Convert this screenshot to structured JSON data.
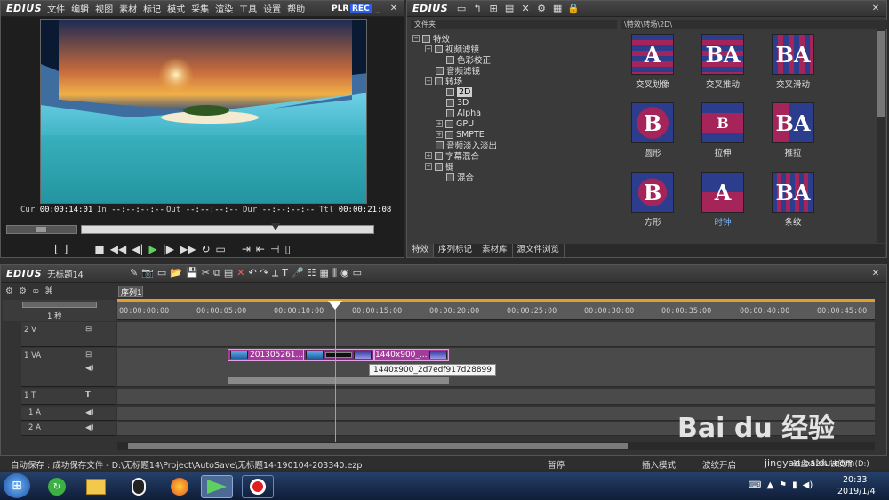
{
  "player": {
    "logo": "EDIUS",
    "menu": [
      "文件",
      "编辑",
      "视图",
      "素材",
      "标记",
      "模式",
      "采集",
      "渲染",
      "工具",
      "设置",
      "帮助"
    ],
    "plr": "PLR",
    "rec": "REC",
    "timecodes": {
      "cur_label": "Cur",
      "cur": "00:00:14:01",
      "in_label": "In",
      "in": "--:--:--:--",
      "out_label": "Out",
      "out": "--:--:--:--",
      "dur_label": "Dur",
      "dur": "--:--:--:--",
      "ttl_label": "Ttl",
      "ttl": "00:00:21:08"
    }
  },
  "bin": {
    "logo": "EDIUS",
    "tree_header": "文件夹",
    "path": "\\特效\\转场\\2D\\",
    "tree": [
      {
        "label": "特效",
        "level": 0
      },
      {
        "label": "视频滤镜",
        "level": 1
      },
      {
        "label": "色彩校正",
        "level": 2
      },
      {
        "label": "音频滤镜",
        "level": 1
      },
      {
        "label": "转场",
        "level": 1
      },
      {
        "label": "2D",
        "level": 2,
        "selected": true
      },
      {
        "label": "3D",
        "level": 2
      },
      {
        "label": "Alpha",
        "level": 2
      },
      {
        "label": "GPU",
        "level": 2
      },
      {
        "label": "SMPTE",
        "level": 2
      },
      {
        "label": "音频淡入淡出",
        "level": 1
      },
      {
        "label": "字幕混合",
        "level": 1
      },
      {
        "label": "键",
        "level": 1
      },
      {
        "label": "混合",
        "level": 2
      }
    ],
    "effects": [
      {
        "label": "交叉划像",
        "glyph": "A"
      },
      {
        "label": "交叉推动",
        "glyph": "BA"
      },
      {
        "label": "交叉滑动",
        "glyph": "BA"
      },
      {
        "label": "圆形",
        "glyph": "B"
      },
      {
        "label": "拉伸",
        "glyph": "B"
      },
      {
        "label": "推拉",
        "glyph": "BA"
      },
      {
        "label": "方形",
        "glyph": "B"
      },
      {
        "label": "时钟",
        "glyph": "A"
      },
      {
        "label": "条纹",
        "glyph": "BA"
      }
    ],
    "tabs": [
      "特效",
      "序列标记",
      "素材库",
      "源文件浏览"
    ]
  },
  "timeline": {
    "logo": "EDIUS",
    "project": "无标题14",
    "sequence_tab": "序列1",
    "zoom": "1 秒",
    "ruler": [
      "00:00:00:00",
      "00:00:05:00",
      "00:00:10:00",
      "00:00:15:00",
      "00:00:20:00",
      "00:00:25:00",
      "00:00:30:00",
      "00:00:35:00",
      "00:00:40:00",
      "00:00:45:00"
    ],
    "tracks": [
      {
        "label": "2 V"
      },
      {
        "label": "1 VA"
      },
      {
        "label": "1 T"
      },
      {
        "label": "1 A"
      },
      {
        "label": "2 A"
      }
    ],
    "clip1": "201305261...",
    "clip2": "1440x900_...",
    "tooltip": "1440x900_2d7edf917d28899"
  },
  "status": {
    "autosave": "自动保存 : 成功保存文件 - D:\\无标题14\\Project\\AutoSave\\无标题14-190104-203340.ezp",
    "paused": "暂停",
    "insert": "插入模式",
    "ripple": "波纹开启",
    "disk": "磁盘:52% 被使用 (D:)"
  },
  "taskbar": {
    "time": "20:33",
    "date": "2019/1/4"
  },
  "watermark": {
    "brand": "Bai du 经验",
    "url": "jingyan.baidu.com"
  },
  "colors": {
    "accent_rec": "#2f5fe0",
    "clip": "#a33b9c",
    "playhead": "#46c9c0"
  }
}
